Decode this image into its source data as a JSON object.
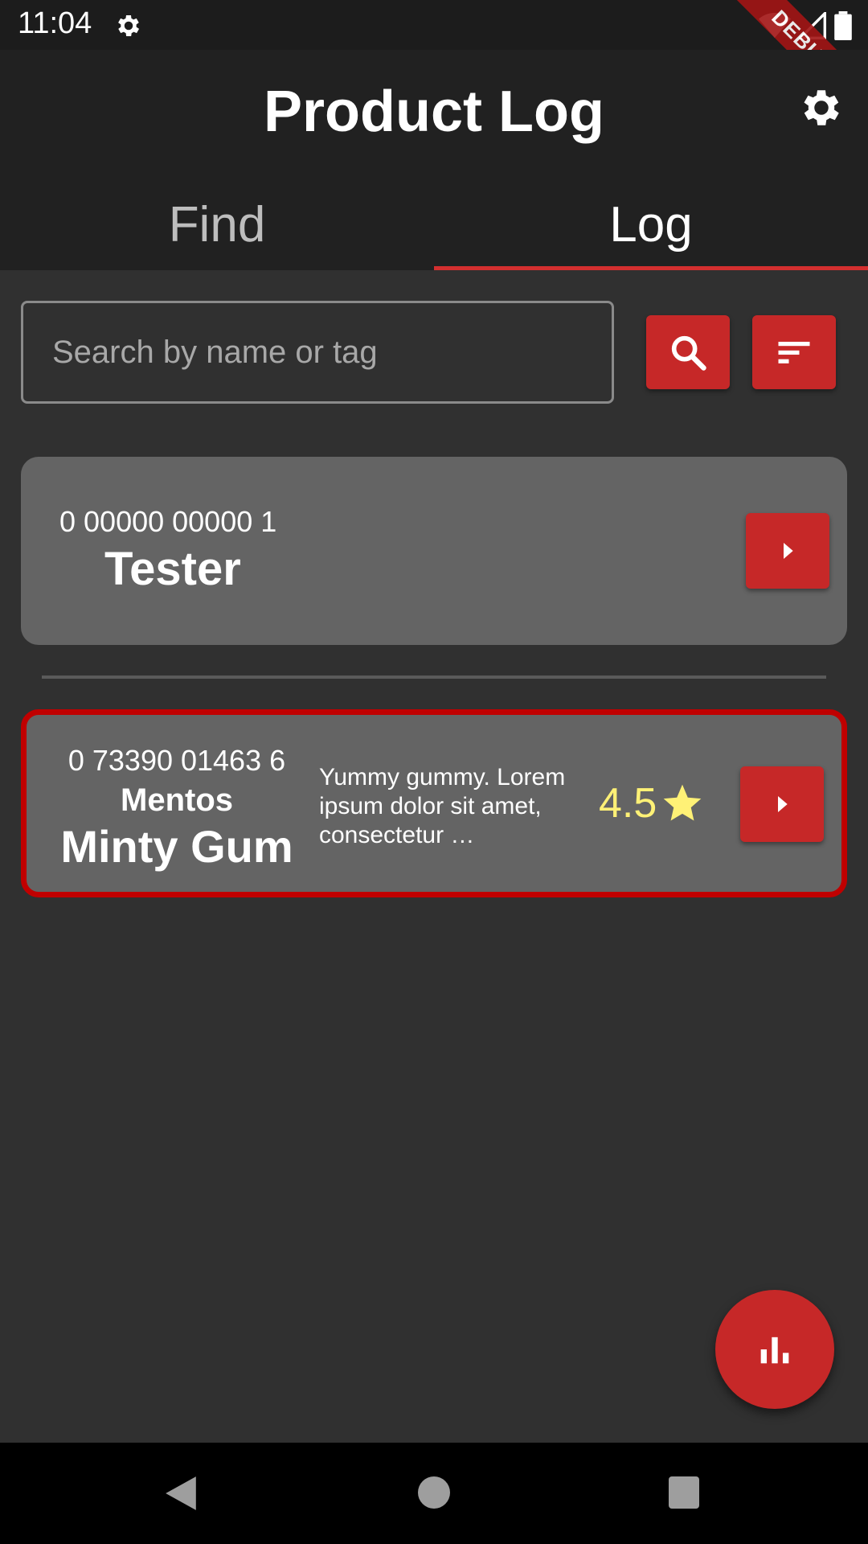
{
  "status_bar": {
    "time": "11:04",
    "icons": [
      "settings-icon",
      "wifi-icon",
      "signal-icon",
      "battery-icon"
    ]
  },
  "debug_banner": "DEBUG",
  "app_bar": {
    "title": "Product Log",
    "settings_icon": "gear-icon"
  },
  "tabs": [
    {
      "label": "Find",
      "selected": false
    },
    {
      "label": "Log",
      "selected": true
    }
  ],
  "search": {
    "placeholder": "Search by name or tag",
    "value": "",
    "search_icon": "search-icon",
    "sort_icon": "sort-icon"
  },
  "products": [
    {
      "upc": "0 00000 00000 1",
      "name": "Tester"
    },
    {
      "upc": "0 73390 01463 6",
      "brand": "Mentos",
      "name": "Minty Gum",
      "description": "Yummy gummy. Lorem ipsum dolor sit amet, consectetur …",
      "rating": "4.5",
      "selected": true
    }
  ],
  "fab": {
    "icon": "bar-chart-icon"
  },
  "colors": {
    "accent": "#c62828",
    "background": "#303030",
    "card": "#646464",
    "rating": "#fff176",
    "selected_border": "#c00000"
  }
}
